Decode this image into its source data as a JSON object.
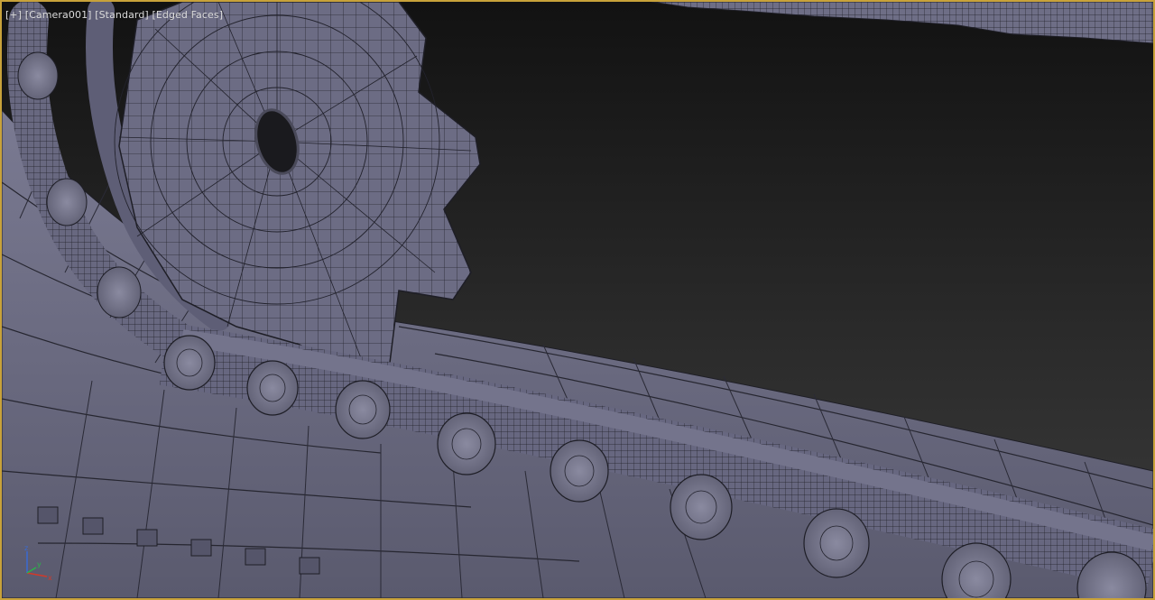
{
  "viewport": {
    "label_parts": [
      "[+]",
      "[Camera001]",
      "[Standard]",
      "[Edged Faces]"
    ],
    "axis_letters": [
      "z",
      "x",
      "y"
    ]
  },
  "colors": {
    "frame": "#c8a23a",
    "background_top": "#121212",
    "background_bottom": "#3c3c3c",
    "mesh_fill": "#6b6b82",
    "mesh_fill_shadow": "#4a4a5c",
    "wire": "#1e1e26",
    "axis_x": "#d23a2a",
    "axis_y": "#2ab34a",
    "axis_z": "#3a6ad2"
  },
  "scene": {
    "objects": [
      "sprocket",
      "roller-chain",
      "track-plates",
      "upper-track"
    ]
  }
}
